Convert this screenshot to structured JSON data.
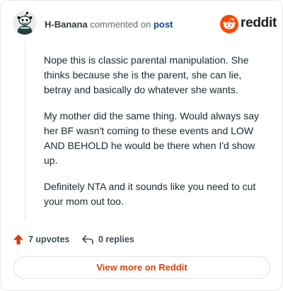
{
  "header": {
    "username": "H-Banana",
    "action_text": "commented on",
    "post_link": "post"
  },
  "brand": {
    "name": "reddit",
    "logo_icon": "reddit-alien-icon",
    "logo_color": "#ff4500"
  },
  "comment": {
    "paragraphs": [
      "Nope this is classic parental manipulation. She thinks because she is the parent, she can lie, betray and basically do whatever she wants.",
      "My mother did the same thing. Would always say her BF wasn't coming to these events and LOW AND BEHOLD he would be there when I'd show up.",
      "Definitely NTA and it sounds like you need to cut your mom out too."
    ]
  },
  "actions": {
    "upvotes_label": "7 upvotes",
    "replies_label": "0 replies",
    "upvote_icon": "upvote-arrow-icon",
    "reply_icon": "reply-arrow-icon",
    "upvote_color": "#d93a00"
  },
  "footer": {
    "view_more_label": "View more on Reddit"
  }
}
